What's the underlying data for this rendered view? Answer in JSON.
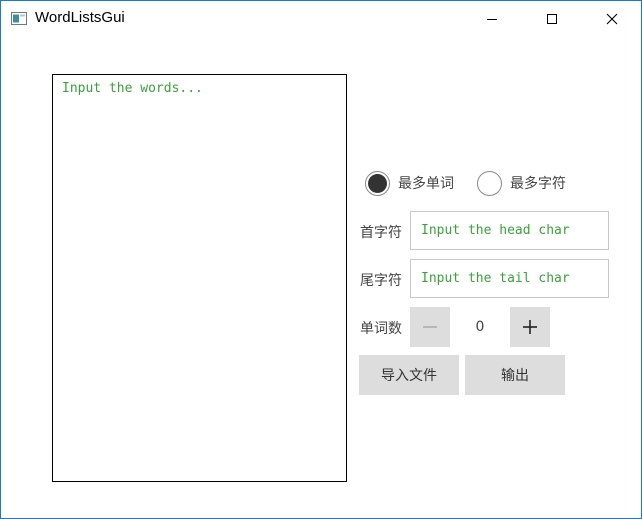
{
  "window": {
    "title": "WordListsGui"
  },
  "editor": {
    "placeholder": "Input the words..."
  },
  "mode": {
    "options": [
      "最多单词",
      "最多字符"
    ],
    "selected": 0
  },
  "head": {
    "label": "首字符",
    "placeholder": "Input the head char"
  },
  "tail": {
    "label": "尾字符",
    "placeholder": "Input the tail char"
  },
  "count": {
    "label": "单词数",
    "value": "0"
  },
  "buttons": {
    "import": "导入文件",
    "output": "输出"
  },
  "icons": {
    "app": "app-window-icon",
    "minimize": "minimize-icon",
    "maximize": "maximize-icon",
    "close": "close-icon",
    "minus": "minus-icon",
    "plus": "plus-icon"
  },
  "colors": {
    "placeholder": "#3aa23a",
    "border_accent": "#1979ca",
    "button_bg": "#dddddd"
  }
}
